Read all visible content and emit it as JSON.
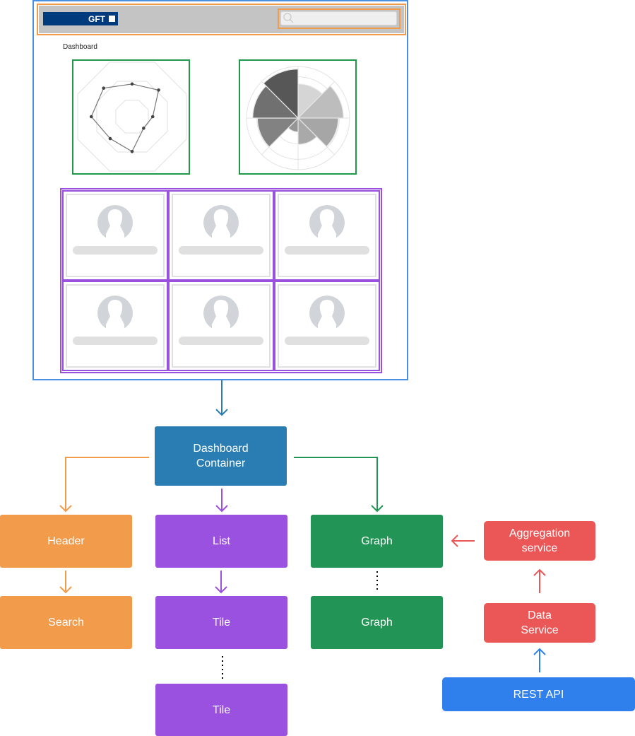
{
  "wireframe": {
    "logo_text": "GFT",
    "search": {
      "placeholder": "",
      "value": "",
      "icon": "search-icon"
    },
    "page_title": "Dashboard",
    "tiles": [
      {
        "icon": "user-avatar-icon"
      },
      {
        "icon": "user-avatar-icon"
      },
      {
        "icon": "user-avatar-icon"
      },
      {
        "icon": "user-avatar-icon"
      },
      {
        "icon": "user-avatar-icon"
      },
      {
        "icon": "user-avatar-icon"
      }
    ]
  },
  "chart_data": [
    {
      "type": "radar",
      "title": "",
      "axes_count": 8,
      "rings": [
        30,
        65,
        100
      ],
      "values": [
        60,
        69,
        38,
        30,
        64,
        57,
        75,
        74
      ],
      "range": [
        0,
        100
      ]
    },
    {
      "type": "polar-area",
      "title": "",
      "sectors": 8,
      "values": [
        66,
        88,
        78,
        51,
        27,
        79,
        88,
        95
      ],
      "range": [
        0,
        100
      ],
      "colors": [
        "#d5d5d5",
        "#bdbdbd",
        "#a6a6a6",
        "#a9a9a9",
        "#959595",
        "#828282",
        "#707070",
        "#575757"
      ]
    }
  ],
  "diagram": {
    "nodes": {
      "container": "Dashboard\nContainer",
      "header": "Header",
      "search": "Search",
      "list": "List",
      "tile1": "Tile",
      "tile2": "Tile",
      "graph1": "Graph",
      "graph2": "Graph",
      "aggregation": "Aggregation\nservice",
      "data_service": "Data\nService",
      "rest_api": "REST API"
    },
    "colors": {
      "frame": "#4a90e2",
      "container": "#2a7db3",
      "header": "#f29b4b",
      "list": "#9b51e0",
      "graph": "#229455",
      "service": "#eb5757",
      "api": "#2f80ed"
    }
  }
}
